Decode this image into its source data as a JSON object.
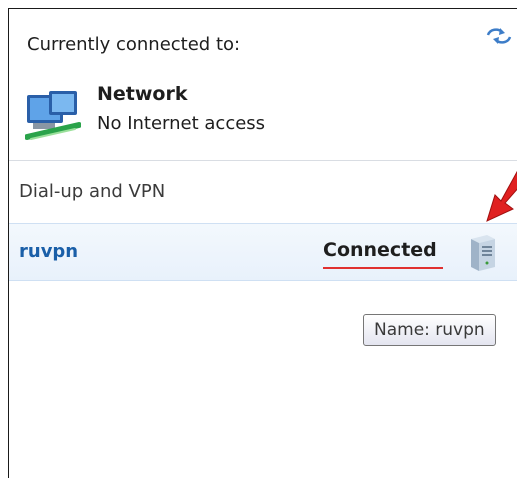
{
  "header": {
    "title": "Currently connected to:",
    "refresh_icon": "refresh-arrows-icon"
  },
  "network": {
    "name": "Network",
    "status": "No Internet access",
    "icon": "network-monitor-icon"
  },
  "section": {
    "label": "Dial-up and VPN"
  },
  "vpn": {
    "name": "ruvpn",
    "status": "Connected",
    "icon": "vpn-server-icon"
  },
  "annotation": {
    "arrow_color": "#e02020",
    "underline_color": "#e03030"
  },
  "tooltip": {
    "text": "Name: ruvpn"
  },
  "colors": {
    "link_blue": "#1a5fa8",
    "row_highlight": "#e8f1fb"
  }
}
